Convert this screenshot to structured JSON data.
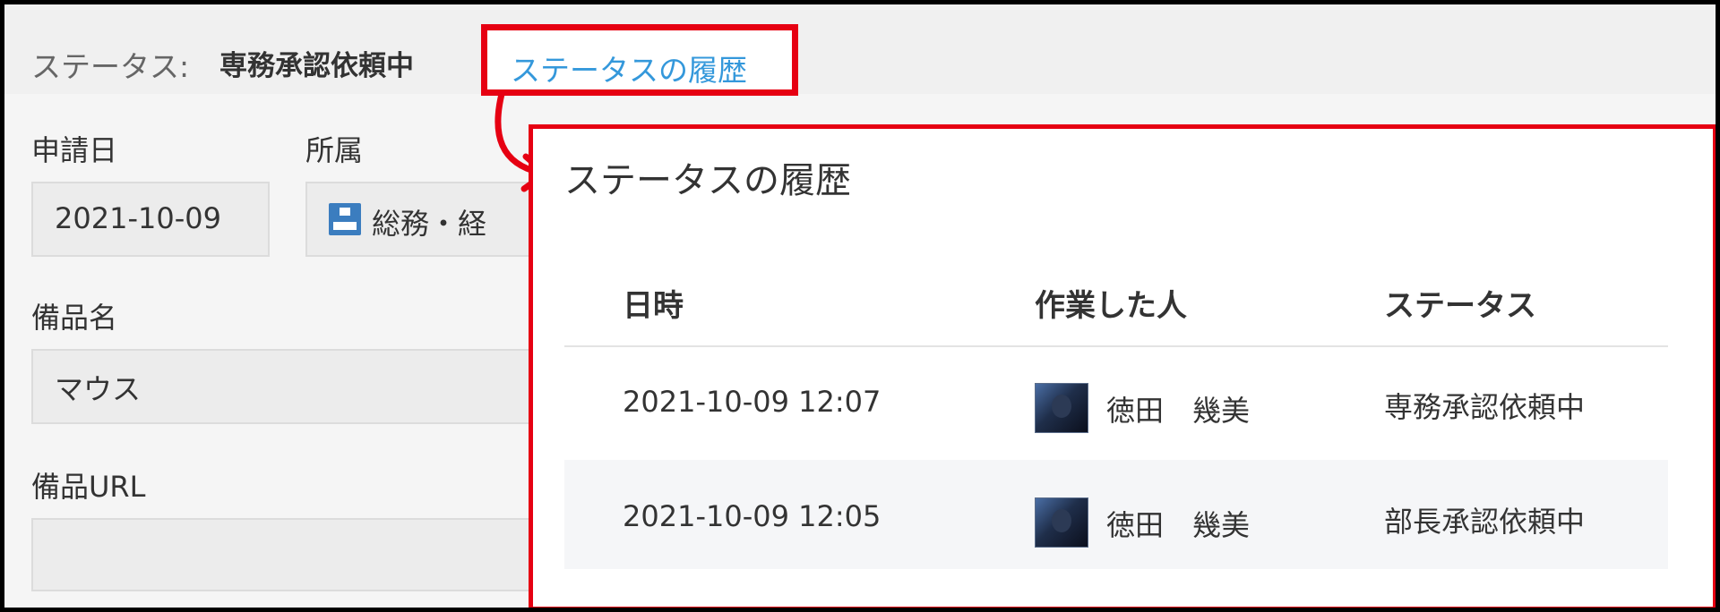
{
  "status_bar": {
    "prefix": "ステータス:",
    "value": "専務承認依頼中",
    "history_link": "ステータスの履歴"
  },
  "form": {
    "application_date": {
      "label": "申請日",
      "value": "2021-10-09"
    },
    "department": {
      "label": "所属",
      "value": "総務・経",
      "icon": "org-chart-icon"
    },
    "item_name": {
      "label": "備品名",
      "value": "マウス"
    },
    "item_url": {
      "label": "備品URL",
      "value": ""
    }
  },
  "popup": {
    "title": "ステータスの履歴",
    "columns": [
      "日時",
      "作業した人",
      "ステータス"
    ],
    "rows": [
      {
        "datetime": "2021-10-09 12:07",
        "user": "徳田　幾美",
        "status": "専務承認依頼中"
      },
      {
        "datetime": "2021-10-09 12:05",
        "user": "徳田　幾美",
        "status": "部長承認依頼中"
      }
    ]
  },
  "colors": {
    "highlight_red": "#e60012",
    "link_blue": "#3498db",
    "org_icon_blue": "#3b7dbf"
  }
}
